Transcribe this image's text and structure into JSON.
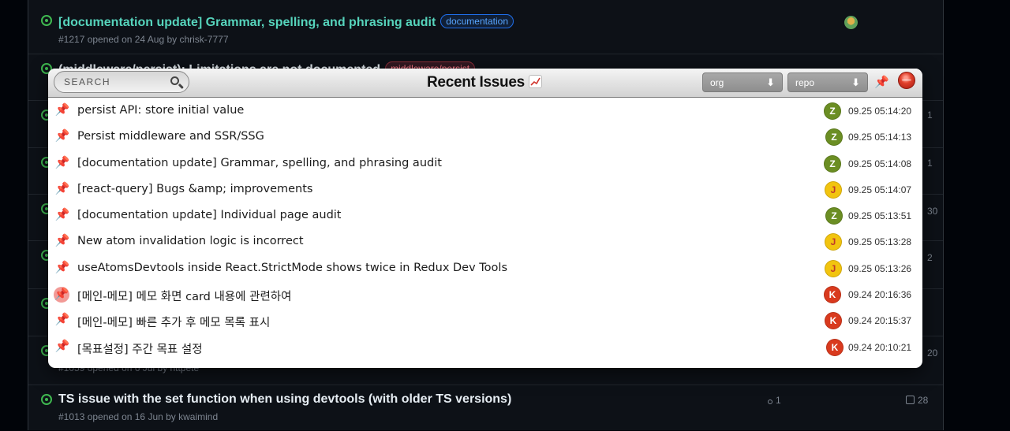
{
  "background_issues": [
    {
      "title": "[documentation update] Grammar, spelling, and phrasing audit",
      "label": "documentation",
      "label_style": "blue",
      "meta": "#1217 opened on 24 Aug by chrisk-7777",
      "visited": true,
      "has_avatar": true
    },
    {
      "title": "(middleware/persist): Limitations are not documented",
      "label": "middleware/persist",
      "label_style": "red",
      "meta": "",
      "visited": false,
      "has_avatar": false
    },
    {
      "title": "",
      "label": "",
      "meta": "",
      "comments": "1"
    },
    {
      "title": "",
      "label": "",
      "meta": "",
      "comments": "1"
    },
    {
      "title": "",
      "label": "",
      "meta": "",
      "comments": "30"
    },
    {
      "title": "",
      "label": "",
      "meta": "",
      "comments": "2"
    },
    {
      "title": "",
      "label": "",
      "meta": "",
      "comments": ""
    },
    {
      "title": "",
      "label": "",
      "meta": "#1059 opened on 6 Jul by httpete",
      "comments": "20"
    },
    {
      "title": "TS issue with the set function when using devtools (with older TS versions)",
      "label": "",
      "meta": "#1013 opened on 16 Jun by kwaimind",
      "prs": "1",
      "comments": "28"
    }
  ],
  "popup": {
    "search_placeholder": "SEARCH",
    "title": "Recent Issues",
    "title_emoji": "chart-increasing-icon",
    "org_dropdown": "org",
    "repo_dropdown": "repo",
    "dropdown_arrow": "⬇",
    "pin_icon": "📌",
    "issues": [
      {
        "title": "persist API: store initial value",
        "avatar": "Z",
        "avatar_color": "#6b8e23",
        "time": "09.25 05:14:20",
        "highlighted": false
      },
      {
        "title": "Persist middleware and SSR/SSG",
        "avatar": "Z",
        "avatar_color": "#6b8e23",
        "time": "09.25 05:14:13",
        "highlighted": false
      },
      {
        "title": "[documentation update] Grammar, spelling, and phrasing audit",
        "avatar": "Z",
        "avatar_color": "#6b8e23",
        "time": "09.25 05:14:08",
        "highlighted": false
      },
      {
        "title": "[react-query] Bugs &amp; improvements",
        "avatar": "J",
        "avatar_color": "#f2c40f",
        "time": "09.25 05:14:07",
        "highlighted": false
      },
      {
        "title": "[documentation update] Individual page audit",
        "avatar": "Z",
        "avatar_color": "#6b8e23",
        "time": "09.25 05:13:51",
        "highlighted": false
      },
      {
        "title": "New atom invalidation logic is incorrect",
        "avatar": "J",
        "avatar_color": "#f2c40f",
        "time": "09.25 05:13:28",
        "highlighted": false
      },
      {
        "title": "useAtomsDevtools inside React.StrictMode shows twice in Redux Dev Tools",
        "avatar": "J",
        "avatar_color": "#f2c40f",
        "time": "09.25 05:13:26",
        "highlighted": false
      },
      {
        "title": "[메인-메모] 메모 화면 card 내용에 관련하여",
        "avatar": "K",
        "avatar_color": "#d93a1e",
        "time": "09.24 20:16:36",
        "highlighted": true
      },
      {
        "title": "[메인-메모] 빠른 추가 후 메모 목록 표시",
        "avatar": "K",
        "avatar_color": "#d93a1e",
        "time": "09.24 20:15:37",
        "highlighted": false
      },
      {
        "title": "[목표설정] 주간 목표 설정",
        "avatar": "K",
        "avatar_color": "#d93a1e",
        "time": "09.24 20:10:21",
        "highlighted": false
      }
    ]
  }
}
